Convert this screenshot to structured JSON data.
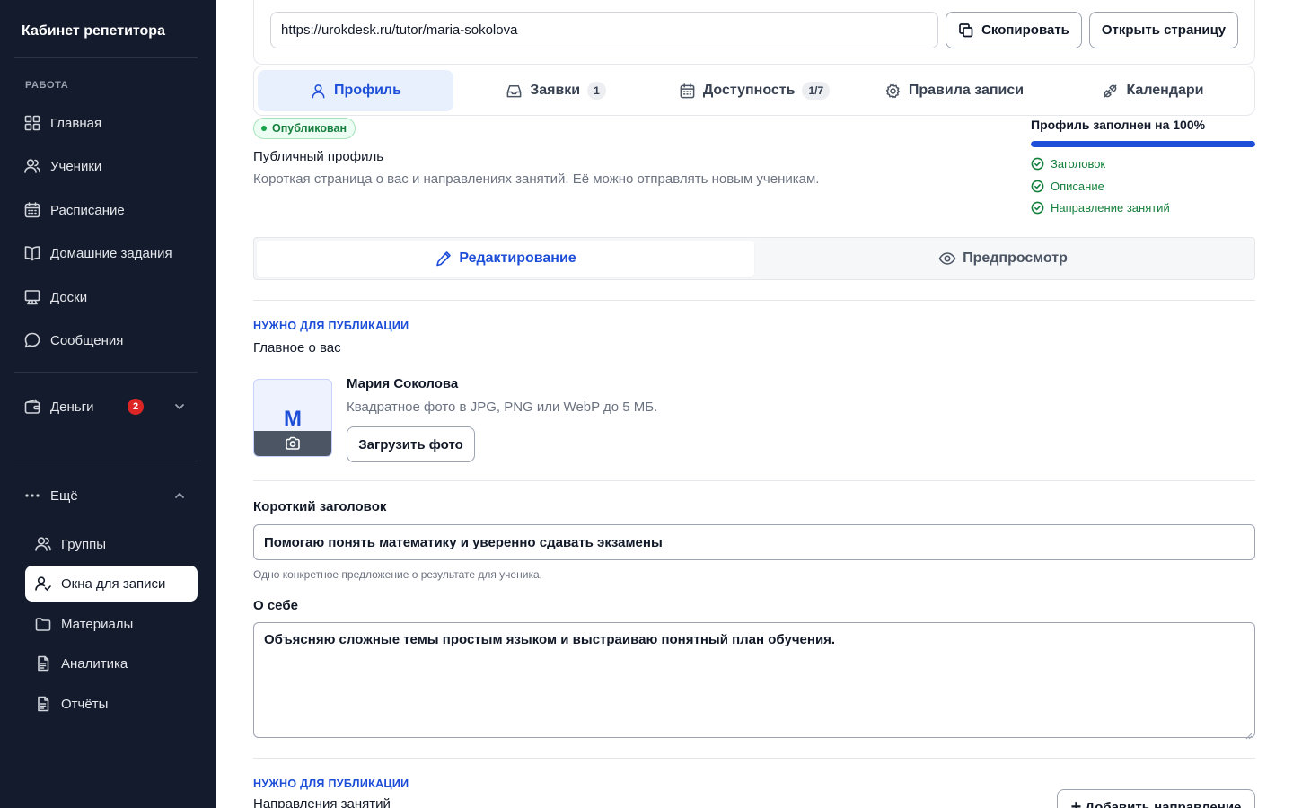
{
  "sidebar": {
    "brand": "Кабинет репетитора",
    "section_work": "РАБОТА",
    "items": [
      {
        "label": "Главная",
        "icon": "dashboard-icon"
      },
      {
        "label": "Ученики",
        "icon": "users-icon"
      },
      {
        "label": "Расписание",
        "icon": "calendar-icon"
      },
      {
        "label": "Домашние задания",
        "icon": "book-icon"
      },
      {
        "label": "Доски",
        "icon": "board-icon"
      },
      {
        "label": "Сообщения",
        "icon": "chat-icon"
      }
    ],
    "money": {
      "label": "Деньги",
      "badge": "2"
    },
    "more": {
      "label": "Ещё"
    },
    "sub_items": [
      {
        "label": "Группы",
        "icon": "users-icon"
      },
      {
        "label": "Окна для записи",
        "icon": "user-check-icon",
        "active": true
      },
      {
        "label": "Материалы",
        "icon": "folder-icon"
      },
      {
        "label": "Аналитика",
        "icon": "document-icon"
      },
      {
        "label": "Отчёты",
        "icon": "document-icon"
      }
    ]
  },
  "header": {
    "url": "https://urokdesk.ru/tutor/maria-sokolova",
    "copy_label": "Скопировать",
    "open_label": "Открыть страницу"
  },
  "tabs": [
    {
      "label": "Профиль",
      "icon": "user-icon",
      "active": true
    },
    {
      "label": "Заявки",
      "icon": "inbox-icon",
      "count": "1"
    },
    {
      "label": "Доступность",
      "icon": "calendar-icon",
      "count": "1/7"
    },
    {
      "label": "Правила записи",
      "icon": "gear-icon"
    },
    {
      "label": "Календари",
      "icon": "plug-icon"
    }
  ],
  "profile": {
    "status": "Опубликован",
    "title": "Публичный профиль",
    "description": "Короткая страница о вас и направлениях занятий. Её можно отправлять новым ученикам.",
    "completion_label": "Профиль заполнен на 100%",
    "completion_fraction": 1.0,
    "checklist": [
      "Заголовок",
      "Описание",
      "Направление занятий"
    ]
  },
  "modes": {
    "edit": "Редактирование",
    "preview": "Предпросмотр"
  },
  "section_main": {
    "required_label": "НУЖНО ДЛЯ ПУБЛИКАЦИИ",
    "title": "Главное о вас",
    "avatar_letter": "М",
    "name": "Мария Соколова",
    "photo_hint": "Квадратное фото в JPG, PNG или WebP до 5 МБ.",
    "upload_label": "Загрузить фото"
  },
  "form": {
    "headline_label": "Короткий заголовок",
    "headline_value": "Помогаю понять математику и уверенно сдавать экзамены",
    "headline_hint": "Одно конкретное предложение о результате для ученика.",
    "about_label": "О себе",
    "about_value": "Объясняю сложные темы простым языком и выстраиваю понятный план обучения."
  },
  "section_directions": {
    "required_label": "НУЖНО ДЛЯ ПУБЛИКАЦИИ",
    "title": "Направления занятий",
    "add_label": "Добавить направление"
  },
  "colors": {
    "sidebar_bg": "#141b2d",
    "accent": "#1d4ed8",
    "success": "#15803d",
    "badge": "#dc2626"
  }
}
